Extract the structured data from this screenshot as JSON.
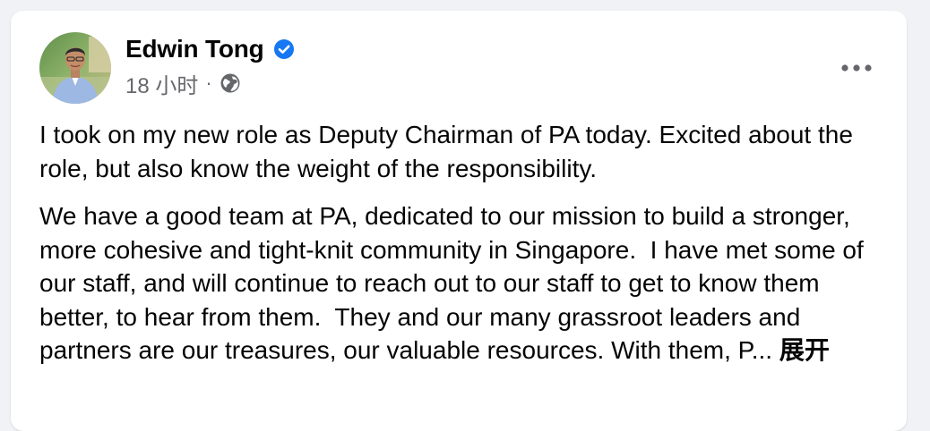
{
  "post": {
    "author": {
      "name": "Edwin Tong",
      "verified": true,
      "avatar_icon": "profile-photo"
    },
    "timestamp": "18 小时",
    "separator": "·",
    "audience_icon": "globe-icon",
    "more_icon": "more-horizontal-icon",
    "paragraphs": [
      "I took on my new role as Deputy Chairman of PA today. Excited about the role, but also know the weight of the responsibility.",
      "We have a good team at PA, dedicated to our mission to build a stronger, more cohesive and tight-knit community in Singapore.  I have met some of our staff, and will continue to reach out to our staff to get to know them better, to hear from them.  They and our many grassroot leaders and partners are our treasures, our valuable resources. With them, P..."
    ],
    "see_more_label": "展开"
  },
  "colors": {
    "verified_blue": "#1877f2",
    "secondary_text": "#65676b",
    "page_background": "#f0f2f5"
  }
}
